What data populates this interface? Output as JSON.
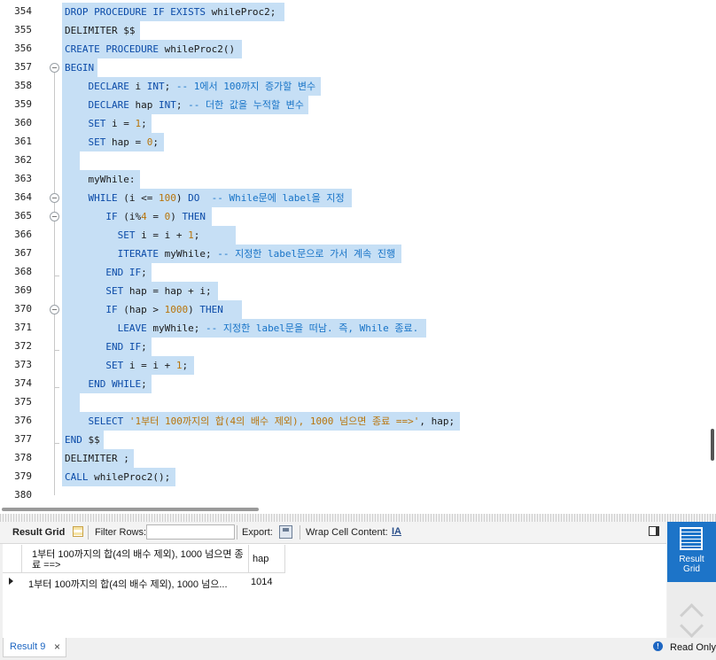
{
  "editor": {
    "lines": [
      {
        "n": "354",
        "indent": 0,
        "hl": true,
        "fold": "none",
        "parts": [
          [
            "kw",
            "DROP PROCEDURE IF EXISTS "
          ],
          [
            "tx",
            "whileProc2;"
          ]
        ]
      },
      {
        "n": "355",
        "indent": 0,
        "hl": true,
        "fold": "none",
        "parts": [
          [
            "tx",
            "DELIMITER $$"
          ]
        ]
      },
      {
        "n": "356",
        "indent": 0,
        "hl": true,
        "fold": "none",
        "parts": [
          [
            "kw",
            "CREATE PROCEDURE "
          ],
          [
            "tx",
            "whileProc2()"
          ]
        ]
      },
      {
        "n": "357",
        "indent": 0,
        "hl": true,
        "fold": "open",
        "parts": [
          [
            "kw",
            "BEGIN"
          ]
        ]
      },
      {
        "n": "358",
        "indent": 4,
        "hl": true,
        "fold": "in",
        "parts": [
          [
            "kw",
            "DECLARE "
          ],
          [
            "tx",
            "i "
          ],
          [
            "kw",
            "INT"
          ],
          [
            "tx",
            "; "
          ],
          [
            "cm",
            "-- 1에서 100까지 증가할 변수"
          ]
        ]
      },
      {
        "n": "359",
        "indent": 4,
        "hl": true,
        "fold": "in",
        "parts": [
          [
            "kw",
            "DECLARE "
          ],
          [
            "tx",
            "hap "
          ],
          [
            "kw",
            "INT"
          ],
          [
            "tx",
            "; "
          ],
          [
            "cm",
            "-- 더한 값을 누적할 변수"
          ]
        ]
      },
      {
        "n": "360",
        "indent": 4,
        "hl": true,
        "fold": "in",
        "parts": [
          [
            "kw",
            "SET "
          ],
          [
            "tx",
            "i = "
          ],
          [
            "num",
            "1"
          ],
          [
            "tx",
            ";"
          ]
        ]
      },
      {
        "n": "361",
        "indent": 4,
        "hl": true,
        "fold": "in",
        "parts": [
          [
            "kw",
            "SET "
          ],
          [
            "tx",
            "hap = "
          ],
          [
            "num",
            "0"
          ],
          [
            "tx",
            ";"
          ]
        ]
      },
      {
        "n": "362",
        "indent": 0,
        "hl": true,
        "fold": "in",
        "parts": [
          [
            "tx",
            "  "
          ]
        ]
      },
      {
        "n": "363",
        "indent": 4,
        "hl": true,
        "fold": "in",
        "parts": [
          [
            "tx",
            "myWhile:"
          ]
        ]
      },
      {
        "n": "364",
        "indent": 4,
        "hl": true,
        "fold": "open",
        "parts": [
          [
            "kw",
            "WHILE "
          ],
          [
            "tx",
            "(i <= "
          ],
          [
            "num",
            "100"
          ],
          [
            "tx",
            ") "
          ],
          [
            "kw",
            "DO"
          ],
          [
            "tx",
            "  "
          ],
          [
            "cm",
            "-- While문에 label을 지정"
          ]
        ]
      },
      {
        "n": "365",
        "indent": 7,
        "hl": true,
        "fold": "open",
        "parts": [
          [
            "kw",
            "IF "
          ],
          [
            "tx",
            "(i%"
          ],
          [
            "num",
            "4"
          ],
          [
            "tx",
            " = "
          ],
          [
            "num",
            "0"
          ],
          [
            "tx",
            ") "
          ],
          [
            "kw",
            "THEN"
          ]
        ]
      },
      {
        "n": "366",
        "indent": 9,
        "hl": true,
        "fold": "in",
        "parts": [
          [
            "kw",
            "SET "
          ],
          [
            "tx",
            "i = i + "
          ],
          [
            "num",
            "1"
          ],
          [
            "tx",
            ";     "
          ]
        ]
      },
      {
        "n": "367",
        "indent": 9,
        "hl": true,
        "fold": "in",
        "parts": [
          [
            "kw",
            "ITERATE "
          ],
          [
            "tx",
            "myWhile; "
          ],
          [
            "cm",
            "-- 지정한 label문으로 가서 계속 진행"
          ]
        ]
      },
      {
        "n": "368",
        "indent": 7,
        "hl": true,
        "fold": "end",
        "parts": [
          [
            "kw",
            "END IF"
          ],
          [
            "tx",
            ";"
          ]
        ]
      },
      {
        "n": "369",
        "indent": 7,
        "hl": true,
        "fold": "in",
        "parts": [
          [
            "kw",
            "SET "
          ],
          [
            "tx",
            "hap = hap + i;"
          ]
        ]
      },
      {
        "n": "370",
        "indent": 7,
        "hl": true,
        "fold": "open",
        "parts": [
          [
            "kw",
            "IF "
          ],
          [
            "tx",
            "(hap > "
          ],
          [
            "num",
            "1000"
          ],
          [
            "tx",
            ") "
          ],
          [
            "kw",
            "THEN"
          ],
          [
            "tx",
            "  "
          ]
        ]
      },
      {
        "n": "371",
        "indent": 9,
        "hl": true,
        "fold": "in",
        "parts": [
          [
            "kw",
            "LEAVE "
          ],
          [
            "tx",
            "myWhile; "
          ],
          [
            "cm",
            "-- 지정한 label문을 떠남. 즉, While 종료."
          ]
        ]
      },
      {
        "n": "372",
        "indent": 7,
        "hl": true,
        "fold": "end",
        "parts": [
          [
            "kw",
            "END IF"
          ],
          [
            "tx",
            ";"
          ]
        ]
      },
      {
        "n": "373",
        "indent": 7,
        "hl": true,
        "fold": "in",
        "parts": [
          [
            "kw",
            "SET "
          ],
          [
            "tx",
            "i = i + "
          ],
          [
            "num",
            "1"
          ],
          [
            "tx",
            ";"
          ]
        ]
      },
      {
        "n": "374",
        "indent": 4,
        "hl": true,
        "fold": "end",
        "parts": [
          [
            "kw",
            "END WHILE"
          ],
          [
            "tx",
            ";"
          ]
        ]
      },
      {
        "n": "375",
        "indent": 0,
        "hl": true,
        "fold": "in",
        "parts": [
          [
            "tx",
            "  "
          ]
        ]
      },
      {
        "n": "376",
        "indent": 4,
        "hl": true,
        "fold": "in",
        "parts": [
          [
            "kw",
            "SELECT "
          ],
          [
            "st",
            "'1부터 100까지의 합(4의 배수 제외), 1000 넘으면 종료 ==>'"
          ],
          [
            "tx",
            ", hap;"
          ]
        ]
      },
      {
        "n": "377",
        "indent": 0,
        "hl": true,
        "fold": "end",
        "parts": [
          [
            "kw",
            "END "
          ],
          [
            "tx",
            "$$"
          ]
        ]
      },
      {
        "n": "378",
        "indent": 0,
        "hl": true,
        "fold": "none",
        "parts": [
          [
            "tx",
            "DELIMITER ;"
          ]
        ]
      },
      {
        "n": "379",
        "indent": 0,
        "hl": true,
        "fold": "none",
        "parts": [
          [
            "kw",
            "CALL "
          ],
          [
            "tx",
            "whileProc2();"
          ]
        ]
      },
      {
        "n": "380",
        "indent": 0,
        "hl": false,
        "fold": "none",
        "parts": []
      }
    ]
  },
  "toolbar": {
    "result_grid_label": "Result Grid",
    "filter_rows_label": "Filter Rows:",
    "filter_rows_value": "",
    "export_label": "Export:",
    "wrap_label": "Wrap Cell Content:",
    "wrap_icon_glyph": "IA"
  },
  "grid": {
    "columns": [
      "1부터 100까지의 합(4의 배수 제외), 1000 넘으면 종료 ==>",
      "hap"
    ],
    "rows": [
      [
        "1부터 100까지의 합(4의 배수 제외), 1000 넘으...",
        "1014"
      ]
    ]
  },
  "side": {
    "result_grid_line1": "Result",
    "result_grid_line2": "Grid"
  },
  "status": {
    "tab_label": "Result 9",
    "close_glyph": "×",
    "mode": "Read Only",
    "info_glyph": "!"
  }
}
